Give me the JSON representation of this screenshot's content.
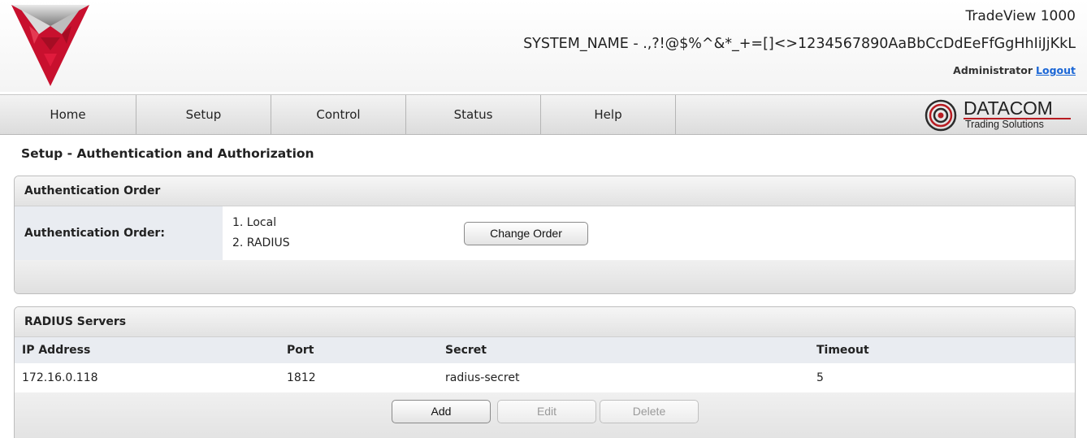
{
  "header": {
    "product": "TradeView 1000",
    "system_name": "SYSTEM_NAME - .,?!@$%^&*_+=[]<>1234567890AaBbCcDdEeFfGgHhIiJjKkL",
    "user": "Administrator",
    "logout_label": "Logout"
  },
  "nav": {
    "items": [
      {
        "label": "Home"
      },
      {
        "label": "Setup"
      },
      {
        "label": "Control"
      },
      {
        "label": "Status"
      },
      {
        "label": "Help"
      }
    ],
    "brand": {
      "name": "DATACOM",
      "tagline": "Trading Solutions"
    }
  },
  "page": {
    "title": "Setup - Authentication and Authorization"
  },
  "auth_order": {
    "panel_title": "Authentication Order",
    "label": "Authentication Order:",
    "items": [
      "1. Local",
      "2. RADIUS"
    ],
    "change_button": "Change Order"
  },
  "radius": {
    "panel_title": "RADIUS Servers",
    "columns": [
      "IP Address",
      "Port",
      "Secret",
      "Timeout"
    ],
    "rows": [
      {
        "ip": "172.16.0.118",
        "port": "1812",
        "secret": "radius-secret",
        "timeout": "5"
      }
    ],
    "buttons": {
      "add": "Add",
      "edit": "Edit",
      "delete": "Delete"
    }
  },
  "colors": {
    "logo_red": "#c8102e",
    "link_blue": "#1a66d6",
    "brand_red": "#b81c22",
    "label_bg": "#e9ecf1"
  }
}
